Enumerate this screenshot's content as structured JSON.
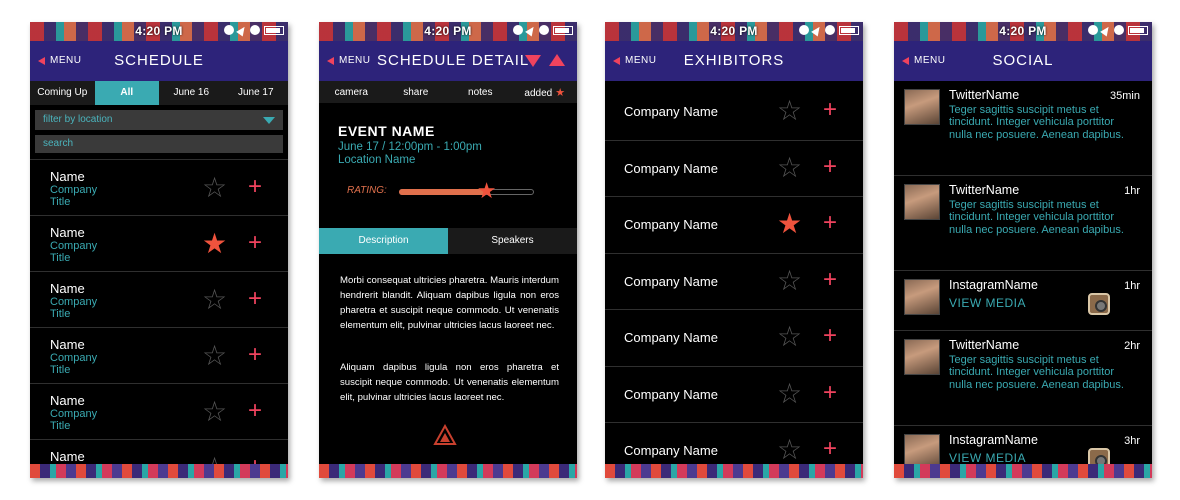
{
  "status_time": "4:20 PM",
  "menu_label": "MENU",
  "colors": {
    "nav_bar": "#2d237a",
    "accent_teal": "#3aaab2",
    "accent_red": "#f0435e",
    "star_on": "#f0533d"
  },
  "screens": {
    "schedule": {
      "title": "SCHEDULE",
      "tabs": [
        "Coming Up",
        "All",
        "June 16",
        "June 17"
      ],
      "active_tab": "All",
      "filter_placeholder": "filter by location",
      "search_placeholder": "search",
      "items": [
        {
          "name": "Name",
          "company": "Company",
          "title": "Title",
          "starred": false
        },
        {
          "name": "Name",
          "company": "Company",
          "title": "Title",
          "starred": true
        },
        {
          "name": "Name",
          "company": "Company",
          "title": "Title",
          "starred": false
        },
        {
          "name": "Name",
          "company": "Company",
          "title": "Title",
          "starred": false
        },
        {
          "name": "Name",
          "company": "Company",
          "title": "Title",
          "starred": false
        },
        {
          "name": "Name",
          "company": "",
          "title": "",
          "starred": false
        }
      ]
    },
    "detail": {
      "title": "SCHEDULE DETAIL",
      "actions": [
        "camera",
        "share",
        "notes",
        "added"
      ],
      "event_name": "EVENT NAME",
      "event_date": "June 17 / 12:00pm - 1:00pm",
      "event_location": "Location Name",
      "rating_label": "RATING:",
      "rating_value": 0.65,
      "segments": [
        "Description",
        "Speakers"
      ],
      "active_segment": "Description",
      "paragraph1": "Morbi consequat ultricies pharetra. Mauris interdum hendrerit blandit. Aliquam dapibus ligula non eros pharetra et suscipit neque commodo. Ut venenatis elementum elit, pulvinar ultricies lacus laoreet nec.",
      "paragraph2": "Aliquam dapibus ligula non eros pharetra et suscipit neque commodo. Ut venenatis elementum elit, pulvinar ultricies lacus laoreet nec."
    },
    "exhibitors": {
      "title": "EXHIBITORS",
      "items": [
        {
          "name": "Company Name",
          "starred": false
        },
        {
          "name": "Company Name",
          "starred": false
        },
        {
          "name": "Company Name",
          "starred": true
        },
        {
          "name": "Company Name",
          "starred": false
        },
        {
          "name": "Company Name",
          "starred": false
        },
        {
          "name": "Company Name",
          "starred": false
        },
        {
          "name": "Company Name",
          "starred": false
        }
      ]
    },
    "social": {
      "title": "SOCIAL",
      "items": [
        {
          "name": "TwitterName",
          "time": "35min",
          "text": "Teger sagittis suscipit metus et tincidunt. Integer vehicula porttitor nulla nec posuere. Aenean dapibus.",
          "type": "twitter"
        },
        {
          "name": "TwitterName",
          "time": "1hr",
          "text": "Teger sagittis suscipit metus et tincidunt. Integer vehicula porttitor nulla nec posuere. Aenean dapibus.",
          "type": "twitter"
        },
        {
          "name": "InstagramName",
          "time": "1hr",
          "text": "VIEW MEDIA",
          "type": "instagram"
        },
        {
          "name": "TwitterName",
          "time": "2hr",
          "text": "Teger sagittis suscipit metus et tincidunt. Integer vehicula porttitor nulla nec posuere. Aenean dapibus.",
          "type": "twitter"
        },
        {
          "name": "InstagramName",
          "time": "3hr",
          "text": "VIEW MEDIA",
          "type": "instagram"
        }
      ]
    }
  }
}
